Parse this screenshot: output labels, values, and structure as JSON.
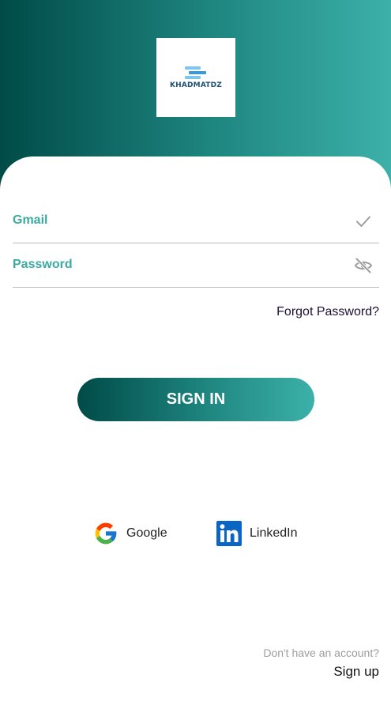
{
  "logo": {
    "text": "KHADMATDZ"
  },
  "form": {
    "gmail_label": "Gmail",
    "password_label": "Password",
    "forgot_password": "Forgot Password?",
    "sign_in": "SIGN IN"
  },
  "social": {
    "google_label": "Google",
    "linkedin_label": "LinkedIn"
  },
  "footer": {
    "no_account": "Don't have an account?",
    "sign_up": "Sign up"
  },
  "colors": {
    "primary_dark": "#004b48",
    "primary_light": "#3cb1a9",
    "label_teal": "#3aaaa2"
  },
  "icons": {
    "gmail_status": "check-icon",
    "password_toggle": "eye-off-icon",
    "google": "google-icon",
    "linkedin": "linkedin-icon"
  }
}
